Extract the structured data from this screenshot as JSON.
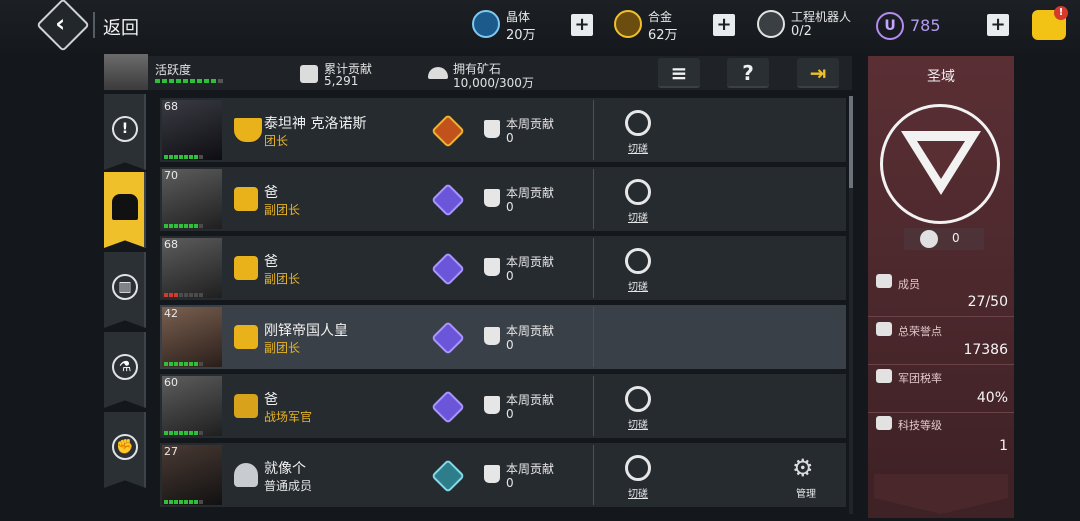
{
  "header": {
    "back_label": "返回",
    "resources": [
      {
        "name": "晶体",
        "value": "20万",
        "icon": "crystal-icon"
      },
      {
        "name": "合金",
        "value": "62万",
        "icon": "alloy-icon"
      },
      {
        "name": "工程机器人",
        "value": "0/2",
        "icon": "robot-icon"
      }
    ],
    "premium": {
      "symbol": "U",
      "value": "785"
    },
    "cart_badge": "!"
  },
  "stats": {
    "activity_label": "活跃度",
    "total_contribution_label": "累计贡献",
    "total_contribution_value": "5,291",
    "ore_label": "拥有矿石",
    "ore_value": "10,000/300万"
  },
  "tools": {
    "list_glyph": "≡",
    "help_glyph": "?",
    "exit_glyph": "⇥"
  },
  "side_tabs": [
    {
      "name": "info",
      "glyph": "!"
    },
    {
      "name": "members",
      "glyph": "●"
    },
    {
      "name": "buildings",
      "glyph": "▥"
    },
    {
      "name": "research",
      "glyph": "⚗"
    },
    {
      "name": "battle",
      "glyph": "✊"
    }
  ],
  "members": [
    {
      "level": "68",
      "name": "泰坦神 克洛诺斯",
      "role": "团长",
      "weekly_label": "本周贡献",
      "weekly_value": "0",
      "action": "切磋",
      "badge": "gold",
      "rank_icon": "commander-rank-icon",
      "activity_on": 7
    },
    {
      "level": "70",
      "name": "爸",
      "role": "副团长",
      "weekly_label": "本周贡献",
      "weekly_value": "0",
      "action": "切磋",
      "badge": "purple",
      "rank_icon": "vice-rank-icon",
      "activity_on": 7
    },
    {
      "level": "68",
      "name": "爸",
      "role": "副团长",
      "weekly_label": "本周贡献",
      "weekly_value": "0",
      "action": "切磋",
      "badge": "purple",
      "rank_icon": "vice-rank-icon",
      "activity_on": 3
    },
    {
      "level": "42",
      "name": "刚铎帝国人皇",
      "role": "副团长",
      "weekly_label": "本周贡献",
      "weekly_value": "0",
      "action": "",
      "badge": "purple",
      "rank_icon": "vice-rank-icon",
      "activity_on": 7
    },
    {
      "level": "60",
      "name": "爸",
      "role": "战场军官",
      "weekly_label": "本周贡献",
      "weekly_value": "0",
      "action": "切磋",
      "badge": "purple",
      "rank_icon": "officer-rank-icon",
      "activity_on": 7
    },
    {
      "level": "27",
      "name": "就像个",
      "role": "普通成员",
      "weekly_label": "本周贡献",
      "weekly_value": "0",
      "action": "切磋",
      "badge": "teal",
      "rank_icon": "member-rank-icon",
      "activity_on": 7,
      "manage": "管理"
    }
  ],
  "domain": {
    "title": "圣域",
    "emblem_value": "0",
    "members_label": "成员",
    "members_value": "27/50",
    "honor_label": "总荣誉点",
    "honor_value": "17386",
    "tax_label": "军团税率",
    "tax_value": "40%",
    "tech_label": "科技等级",
    "tech_value": "1"
  }
}
